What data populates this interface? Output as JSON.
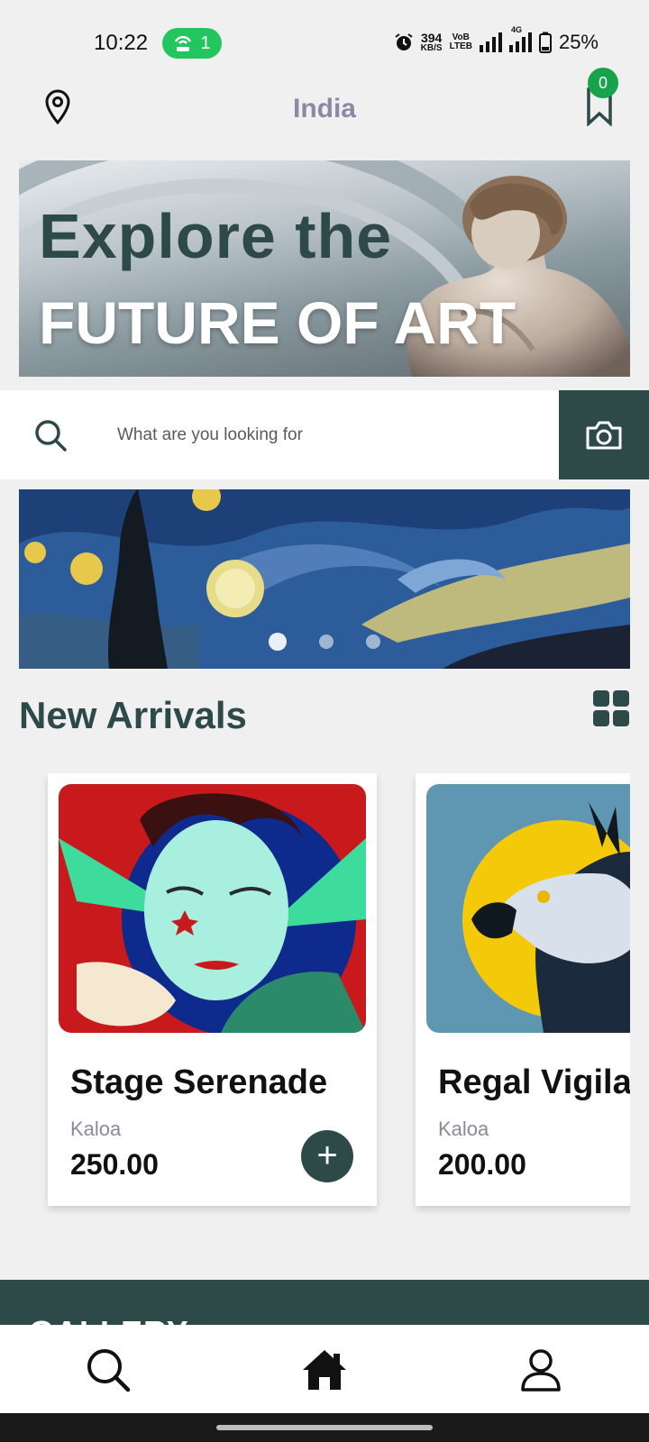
{
  "status_bar": {
    "time": "10:22",
    "hotspot_count": "1",
    "speed_value": "394",
    "speed_unit": "KB/S",
    "volte_top": "VoB",
    "volte_bottom": "LTEB",
    "network_label": "4G",
    "battery": "25%"
  },
  "header": {
    "location": "India",
    "bookmark_count": "0"
  },
  "hero": {
    "line1": "Explore the",
    "line2": "FUTURE OF ART"
  },
  "search": {
    "placeholder": "What are you looking for"
  },
  "carousel": {
    "slide_count": 3,
    "active_index": 0
  },
  "new_arrivals": {
    "title": "New Arrivals",
    "products": [
      {
        "name": "Stage Serenade",
        "artist": "Kaloa",
        "price": "250.00",
        "add_label": "+"
      },
      {
        "name": "Regal Vigila",
        "artist": "Kaloa",
        "price": "200.00"
      }
    ]
  },
  "gallery": {
    "title": "GALLERY"
  },
  "icons": {
    "location": "map-pin-icon",
    "bookmark": "bookmark-icon",
    "search": "search-icon",
    "camera": "camera-icon",
    "grid": "grid-view-icon",
    "home": "home-icon",
    "profile": "user-icon"
  },
  "colors": {
    "primary": "#2d4a48",
    "background": "#f1f0f0",
    "badge": "#16a34a",
    "hotspot": "#22c55e"
  }
}
